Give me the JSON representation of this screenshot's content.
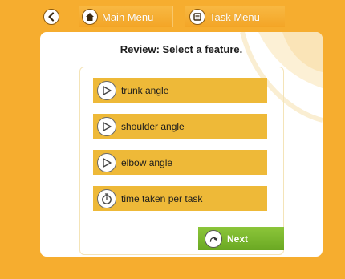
{
  "toolbar": {
    "back_icon": "back-arrow-icon",
    "main_menu_label": "Main Menu",
    "main_menu_icon": "home-icon",
    "task_menu_label": "Task Menu",
    "task_menu_icon": "task-list-icon"
  },
  "review": {
    "title": "Review: Select a feature.",
    "features": [
      {
        "label": "trunk angle",
        "icon": "angle-icon"
      },
      {
        "label": "shoulder angle",
        "icon": "angle-icon"
      },
      {
        "label": "elbow angle",
        "icon": "angle-icon"
      },
      {
        "label": "time taken per task",
        "icon": "stopwatch-icon"
      }
    ],
    "next_label": "Next",
    "next_icon": "next-arrow-icon"
  },
  "colors": {
    "background": "#f6ad2f",
    "feature_bar": "#eeb938",
    "next_button": "#7ab82c"
  }
}
